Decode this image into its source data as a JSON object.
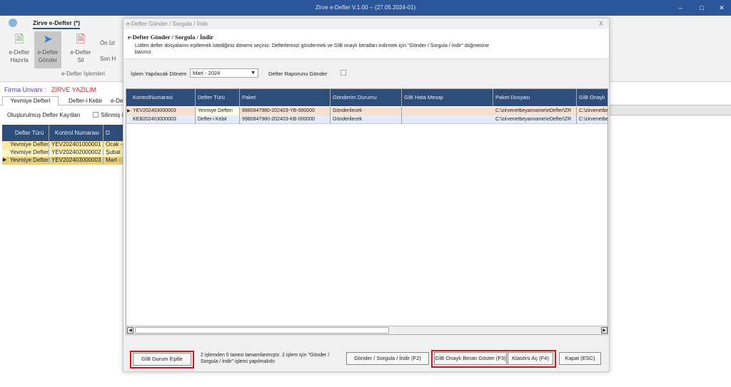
{
  "window": {
    "title": "Zirve e-Defter V.1.00  -- (27.05.2024-01)",
    "minimize": "–",
    "maximize": "□",
    "close": "✕"
  },
  "ribbon": {
    "tab": "Zirve e-Defter (*)",
    "group_label": "e-Defter İşlemleri",
    "buttons": [
      {
        "label1": "e-Defter",
        "label2": "Hazırla",
        "icon": "document-add-icon"
      },
      {
        "label1": "e-Defter",
        "label2": "Gönder",
        "icon": "send-icon"
      },
      {
        "label1": "e-Defter",
        "label2": "Sil",
        "icon": "document-delete-icon"
      }
    ],
    "small_buttons": [
      "Ön İzl",
      "Son H"
    ]
  },
  "main": {
    "firma_label": "Firma Unvanı :",
    "firma_name": "ZİRVE YAZILIM",
    "tabs": [
      "Yevmiye Defteri",
      "Defter-i Kebir",
      "e-De"
    ],
    "records_label": "Oluşturulmuş Defter Kayıtları",
    "deleted_label": "Silinmiş Ka",
    "columns": [
      "Defter Türü",
      "Kontrol Numarası",
      "D"
    ],
    "rows": [
      [
        "Yevmiye Defteri",
        "YEV202401000001",
        "Ocak - 2"
      ],
      [
        "Yevmiye Defteri",
        "YEV202402000002",
        "Şubat -"
      ],
      [
        "Yevmiye Defteri",
        "YEV202403000003",
        "Mart - 2"
      ]
    ]
  },
  "dialog": {
    "title": "e-Defter Gönder / Sorgula / İndir",
    "close": "X",
    "heading": "e-Defter Gönder / Sorgula / İndir",
    "description": "Lütfen defter dosyalarını eşitlemek istediğiniz dönemi seçiniz. Defterlerinizi göndermek ve GİB onaylı beratları indirmek için \"Gönder / Sorgula / İndir\" düğmesine basınız.",
    "period_label": "İşlem Yapılacak Dönem",
    "period_value": "Mart - 2024",
    "report_label": "Defter Raporunu Gönder",
    "columns": [
      "KontrolNumarasi",
      "Defter Türü",
      "Paket",
      "Gönderim Durumu",
      "GİB Hata Mesajı",
      "Paket Dosyası",
      "GİB Onaylı"
    ],
    "rows": [
      [
        "YEV202403000003",
        "Yevmiye Defteri",
        "9980847980-202403-YB-000000",
        "Gönderilecek",
        "",
        "C:\\zirvenetbeyanname\\eDefter\\ZR",
        "C:\\zirvenetbe"
      ],
      [
        "KEB202403000003",
        "Defter-i Kebir",
        "9980847980-202403-KB-000000",
        "Gönderilecek",
        "",
        "C:\\zirvenetbeyanname\\eDefter\\ZR",
        "C:\\zirvenetbe"
      ]
    ],
    "status": "2 işlemden 0 tanesi tamamlanmıştır. 2 işlem için \"Gönder / Sorgula / İndir\" işlemi yapılmalıdır.",
    "buttons": {
      "sync": "GİB Durum Eşitle",
      "send": "Gönder / Sorgula / İndir (F2)",
      "show": "GİB Onaylı Beratı Göster (F3)",
      "folder": "Klasörü Aç (F4)",
      "close": "Kapat (ESC)"
    }
  },
  "colors": {
    "titlebar": "#2b579a",
    "grid_header": "#2e4d7a",
    "highlight": "#e0101a",
    "firma": "#c0282d"
  }
}
